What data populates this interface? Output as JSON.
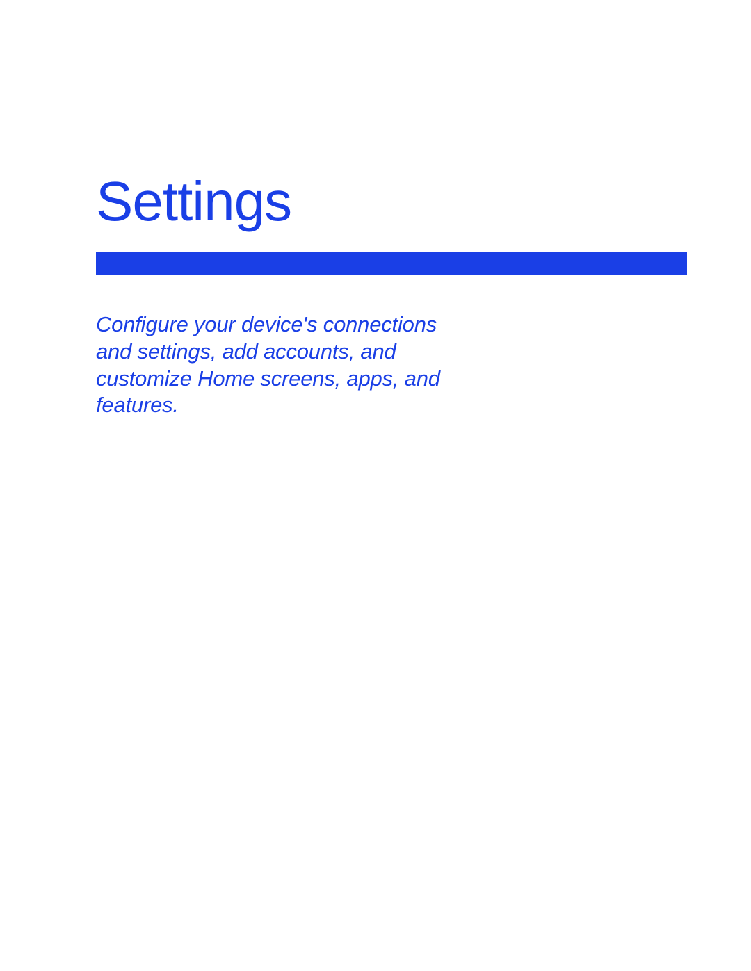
{
  "page": {
    "title": "Settings",
    "description": "Configure your device's connections and settings, add accounts, and customize Home screens, apps, and features."
  },
  "colors": {
    "accent": "#1a3fe6"
  }
}
